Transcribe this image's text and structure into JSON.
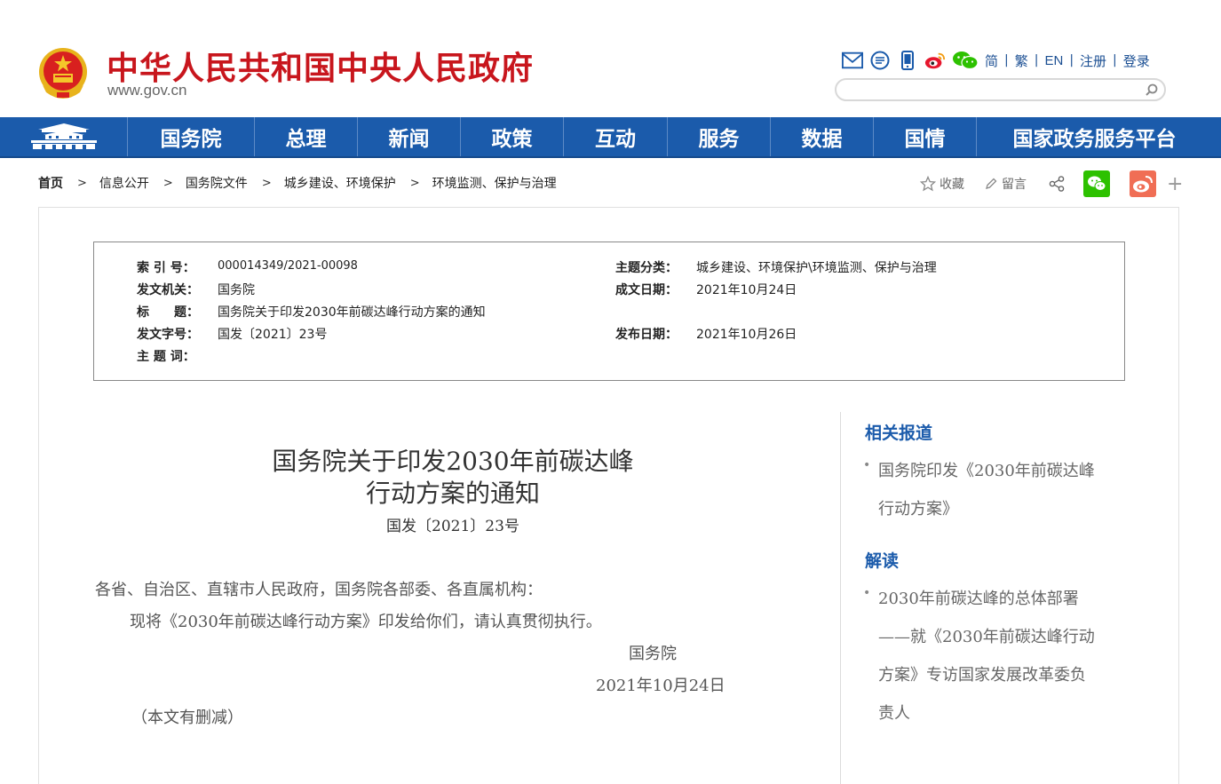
{
  "header": {
    "site_title": "中华人民共和国中央人民政府",
    "site_url": "www.gov.cn",
    "tools": [
      "mail-icon",
      "chat-bubble-icon",
      "mobile-icon",
      "weibo-icon",
      "wechat-icon"
    ],
    "languages": [
      "简",
      "繁",
      "EN"
    ],
    "register": "注册",
    "login": "登录",
    "search_placeholder": ""
  },
  "nav": {
    "items": [
      "国务院",
      "总理",
      "新闻",
      "政策",
      "互动",
      "服务",
      "数据",
      "国情",
      "国家政务服务平台"
    ]
  },
  "breadcrumb": [
    "首页",
    "信息公开",
    "国务院文件",
    "城乡建设、环境保护",
    "环境监测、保护与治理"
  ],
  "share": {
    "favorite": "收藏",
    "comment": "留言"
  },
  "info": {
    "index_label": "索 引 号：",
    "index_value": "000014349/2021-00098",
    "issuer_label": "发文机关：",
    "issuer_value": "国务院",
    "title_label": "标　　题：",
    "title_value": "国务院关于印发2030年前碳达峰行动方案的通知",
    "docno_label": "发文字号：",
    "docno_value": "国发〔2021〕23号",
    "keywords_label": "主 题 词：",
    "keywords_value": "",
    "topic_label": "主题分类：",
    "topic_value": "城乡建设、环境保护\\环境监测、保护与治理",
    "written_label": "成文日期：",
    "written_value": "2021年10月24日",
    "published_label": "发布日期：",
    "published_value": "2021年10月26日"
  },
  "article": {
    "title_line1": "国务院关于印发2030年前碳达峰",
    "title_line2": "行动方案的通知",
    "doc_number": "国发〔2021〕23号",
    "salutation": "各省、自治区、直辖市人民政府，国务院各部委、各直属机构：",
    "body": "现将《2030年前碳达峰行动方案》印发给你们，请认真贯彻执行。",
    "signature": "国务院",
    "date": "2021年10月24日",
    "note": "（本文有删减）"
  },
  "sidebar": {
    "related_heading": "相关报道",
    "related_link_line1": "国务院印发《2030年前碳达峰",
    "related_link_line2": "行动方案》",
    "interpret_heading": "解读",
    "interpret_link_line1": "2030年前碳达峰的总体部署",
    "interpret_link_line2": "——就《2030年前碳达峰行动",
    "interpret_link_line3": "方案》专访国家发展改革委负",
    "interpret_link_line4": "责人"
  },
  "colors": {
    "brand_red": "#c8161d",
    "nav_blue": "#1b5bab",
    "wechat_green": "#2dc100",
    "weibo_red": "#e6162d"
  }
}
